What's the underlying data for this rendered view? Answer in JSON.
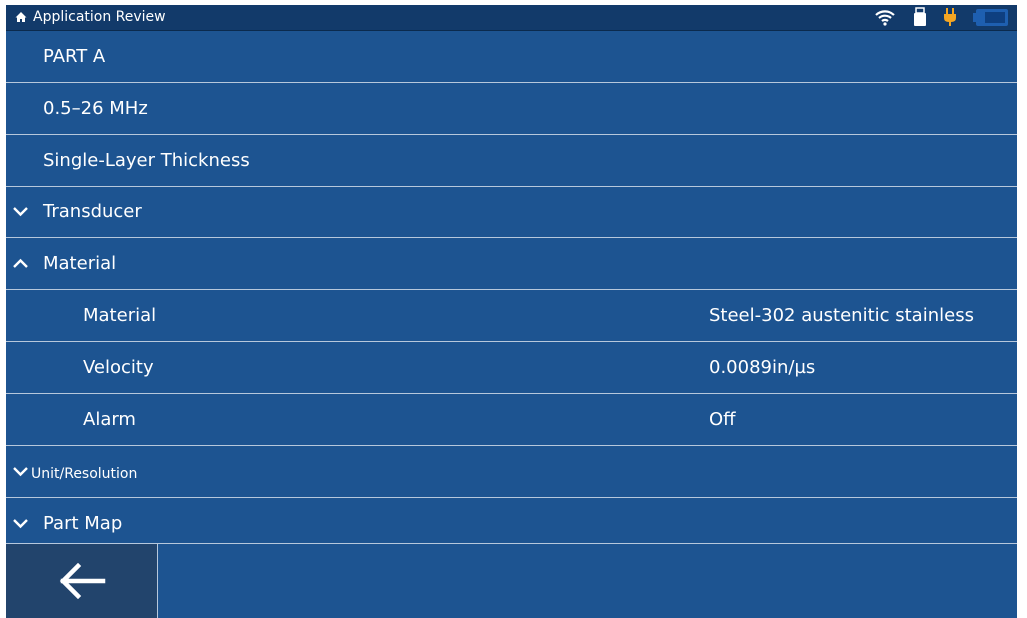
{
  "status_bar": {
    "title": "Application Review",
    "icons": [
      "home-icon",
      "wifi-icon",
      "usb-icon",
      "power-plug-icon",
      "battery-icon"
    ],
    "plug_color": "#f5a623"
  },
  "rows": [
    {
      "label": "PART A"
    },
    {
      "label": "0.5–26 MHz"
    },
    {
      "label": "Single-Layer Thickness"
    },
    {
      "label": "Transducer",
      "state": "collapsed"
    },
    {
      "label": "Material",
      "state": "expanded"
    },
    {
      "label": "Material",
      "value": "Steel-302 austenitic stainless"
    },
    {
      "label": "Velocity",
      "value": "0.0089in/µs"
    },
    {
      "label": "Alarm",
      "value": "Off"
    },
    {
      "label": "Unit/Resolution",
      "state": "collapsed"
    },
    {
      "label": "Part Map",
      "state": "collapsed"
    }
  ],
  "bottom_bar": {
    "back_icon": "back-arrow-icon"
  },
  "colors": {
    "background": "#1d5491",
    "status_bar": "#123a6a",
    "divider": "#b7c8dc",
    "back_button": "#22446c"
  }
}
